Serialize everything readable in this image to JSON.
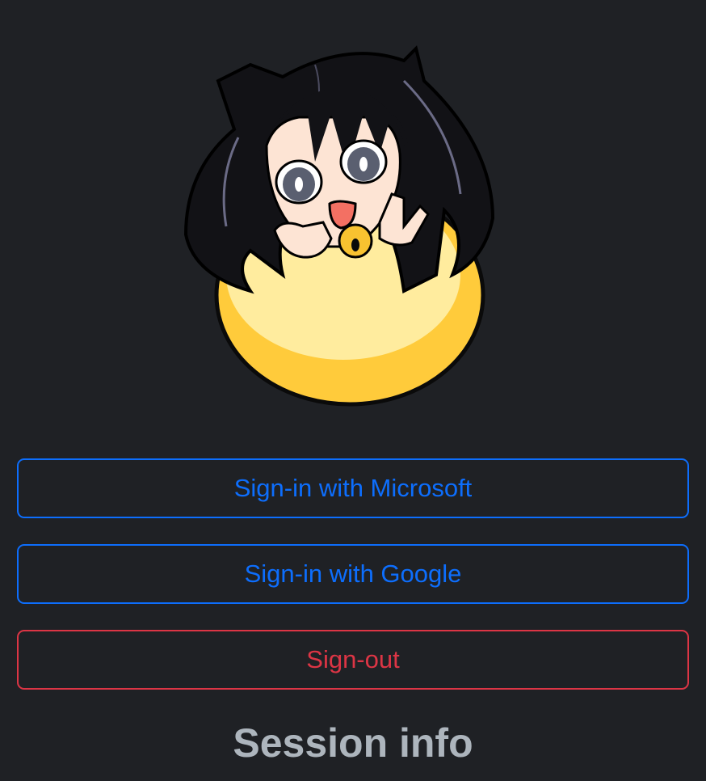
{
  "mascot": {
    "icon": "mascot-girl-in-eggshell-icon",
    "colors": {
      "shell_light": "#ffec9e",
      "shell_dark": "#ffcb3b",
      "hair": "#121216",
      "skin": "#fde4d4",
      "eyes": "#5a5f70",
      "mouth": "#f37063",
      "bell": "#f8c230"
    }
  },
  "auth": {
    "microsoft_label": "Sign-in with Microsoft",
    "google_label": "Sign-in with Google",
    "signout_label": "Sign-out"
  },
  "session": {
    "title": "Session info"
  },
  "colors": {
    "background": "#1f2125",
    "primary": "#0d6efd",
    "danger": "#dc3545",
    "heading": "#adb5bd"
  }
}
